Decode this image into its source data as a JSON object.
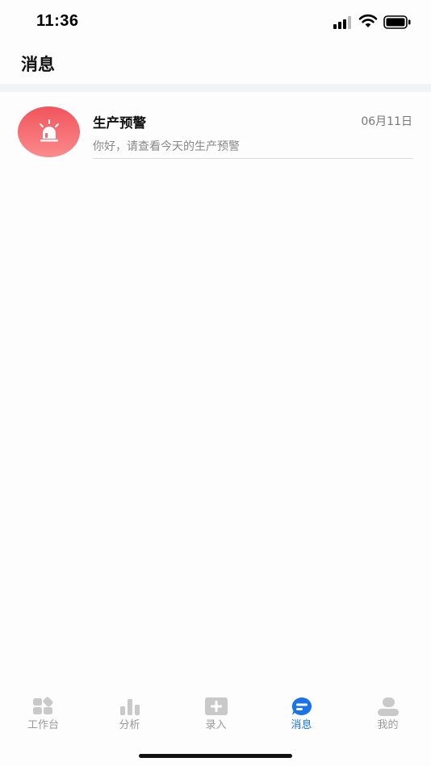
{
  "status_bar": {
    "time": "11:36"
  },
  "header": {
    "title": "消息"
  },
  "messages": [
    {
      "icon": "alarm-light-icon",
      "title": "生产预警",
      "date": "06月11日",
      "preview": "你好，请查看今天的生产预警",
      "avatar_color": "#f05a60"
    }
  ],
  "tab_bar": {
    "active_color": "#1a73e8",
    "inactive_color": "#bbbbbb",
    "tabs": [
      {
        "label": "工作台",
        "icon": "dashboard-icon"
      },
      {
        "label": "分析",
        "icon": "bar-chart-icon"
      },
      {
        "label": "录入",
        "icon": "add-entry-icon"
      },
      {
        "label": "消息",
        "icon": "message-icon",
        "active": true
      },
      {
        "label": "我的",
        "icon": "profile-icon"
      }
    ]
  }
}
